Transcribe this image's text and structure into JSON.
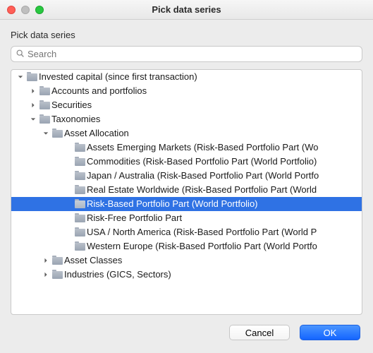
{
  "window": {
    "title": "Pick data series"
  },
  "dialog": {
    "label": "Pick data series",
    "search_placeholder": "Search",
    "search_value": ""
  },
  "tree": {
    "rows": [
      {
        "level": 0,
        "arrow": "down",
        "label": "Invested capital (since first transaction)",
        "selected": false
      },
      {
        "level": 1,
        "arrow": "right",
        "label": "Accounts and portfolios",
        "selected": false
      },
      {
        "level": 1,
        "arrow": "right",
        "label": "Securities",
        "selected": false
      },
      {
        "level": 1,
        "arrow": "down",
        "label": "Taxonomies",
        "selected": false
      },
      {
        "level": 2,
        "arrow": "down",
        "label": "Asset Allocation",
        "selected": false
      },
      {
        "level": 3,
        "arrow": "none",
        "label": "Assets Emerging Markets (Risk-Based Portfolio Part (Wo",
        "selected": false
      },
      {
        "level": 3,
        "arrow": "none",
        "label": "Commodities (Risk-Based Portfolio Part (World Portfolio)",
        "selected": false
      },
      {
        "level": 3,
        "arrow": "none",
        "label": "Japan / Australia (Risk-Based Portfolio Part (World Portfo",
        "selected": false
      },
      {
        "level": 3,
        "arrow": "none",
        "label": "Real Estate Worldwide (Risk-Based Portfolio Part (World",
        "selected": false
      },
      {
        "level": 3,
        "arrow": "none",
        "label": "Risk-Based Portfolio Part (World Portfolio)",
        "selected": true
      },
      {
        "level": 3,
        "arrow": "none",
        "label": "Risk-Free Portfolio Part",
        "selected": false
      },
      {
        "level": 3,
        "arrow": "none",
        "label": "USA / North America (Risk-Based Portfolio Part (World P",
        "selected": false
      },
      {
        "level": 3,
        "arrow": "none",
        "label": "Western Europe (Risk-Based Portfolio Part (World Portfo",
        "selected": false
      },
      {
        "level": 2,
        "arrow": "right",
        "label": "Asset Classes",
        "selected": false
      },
      {
        "level": 2,
        "arrow": "right",
        "label": "Industries (GICS, Sectors)",
        "selected": false
      }
    ]
  },
  "buttons": {
    "cancel": "Cancel",
    "ok": "OK"
  }
}
